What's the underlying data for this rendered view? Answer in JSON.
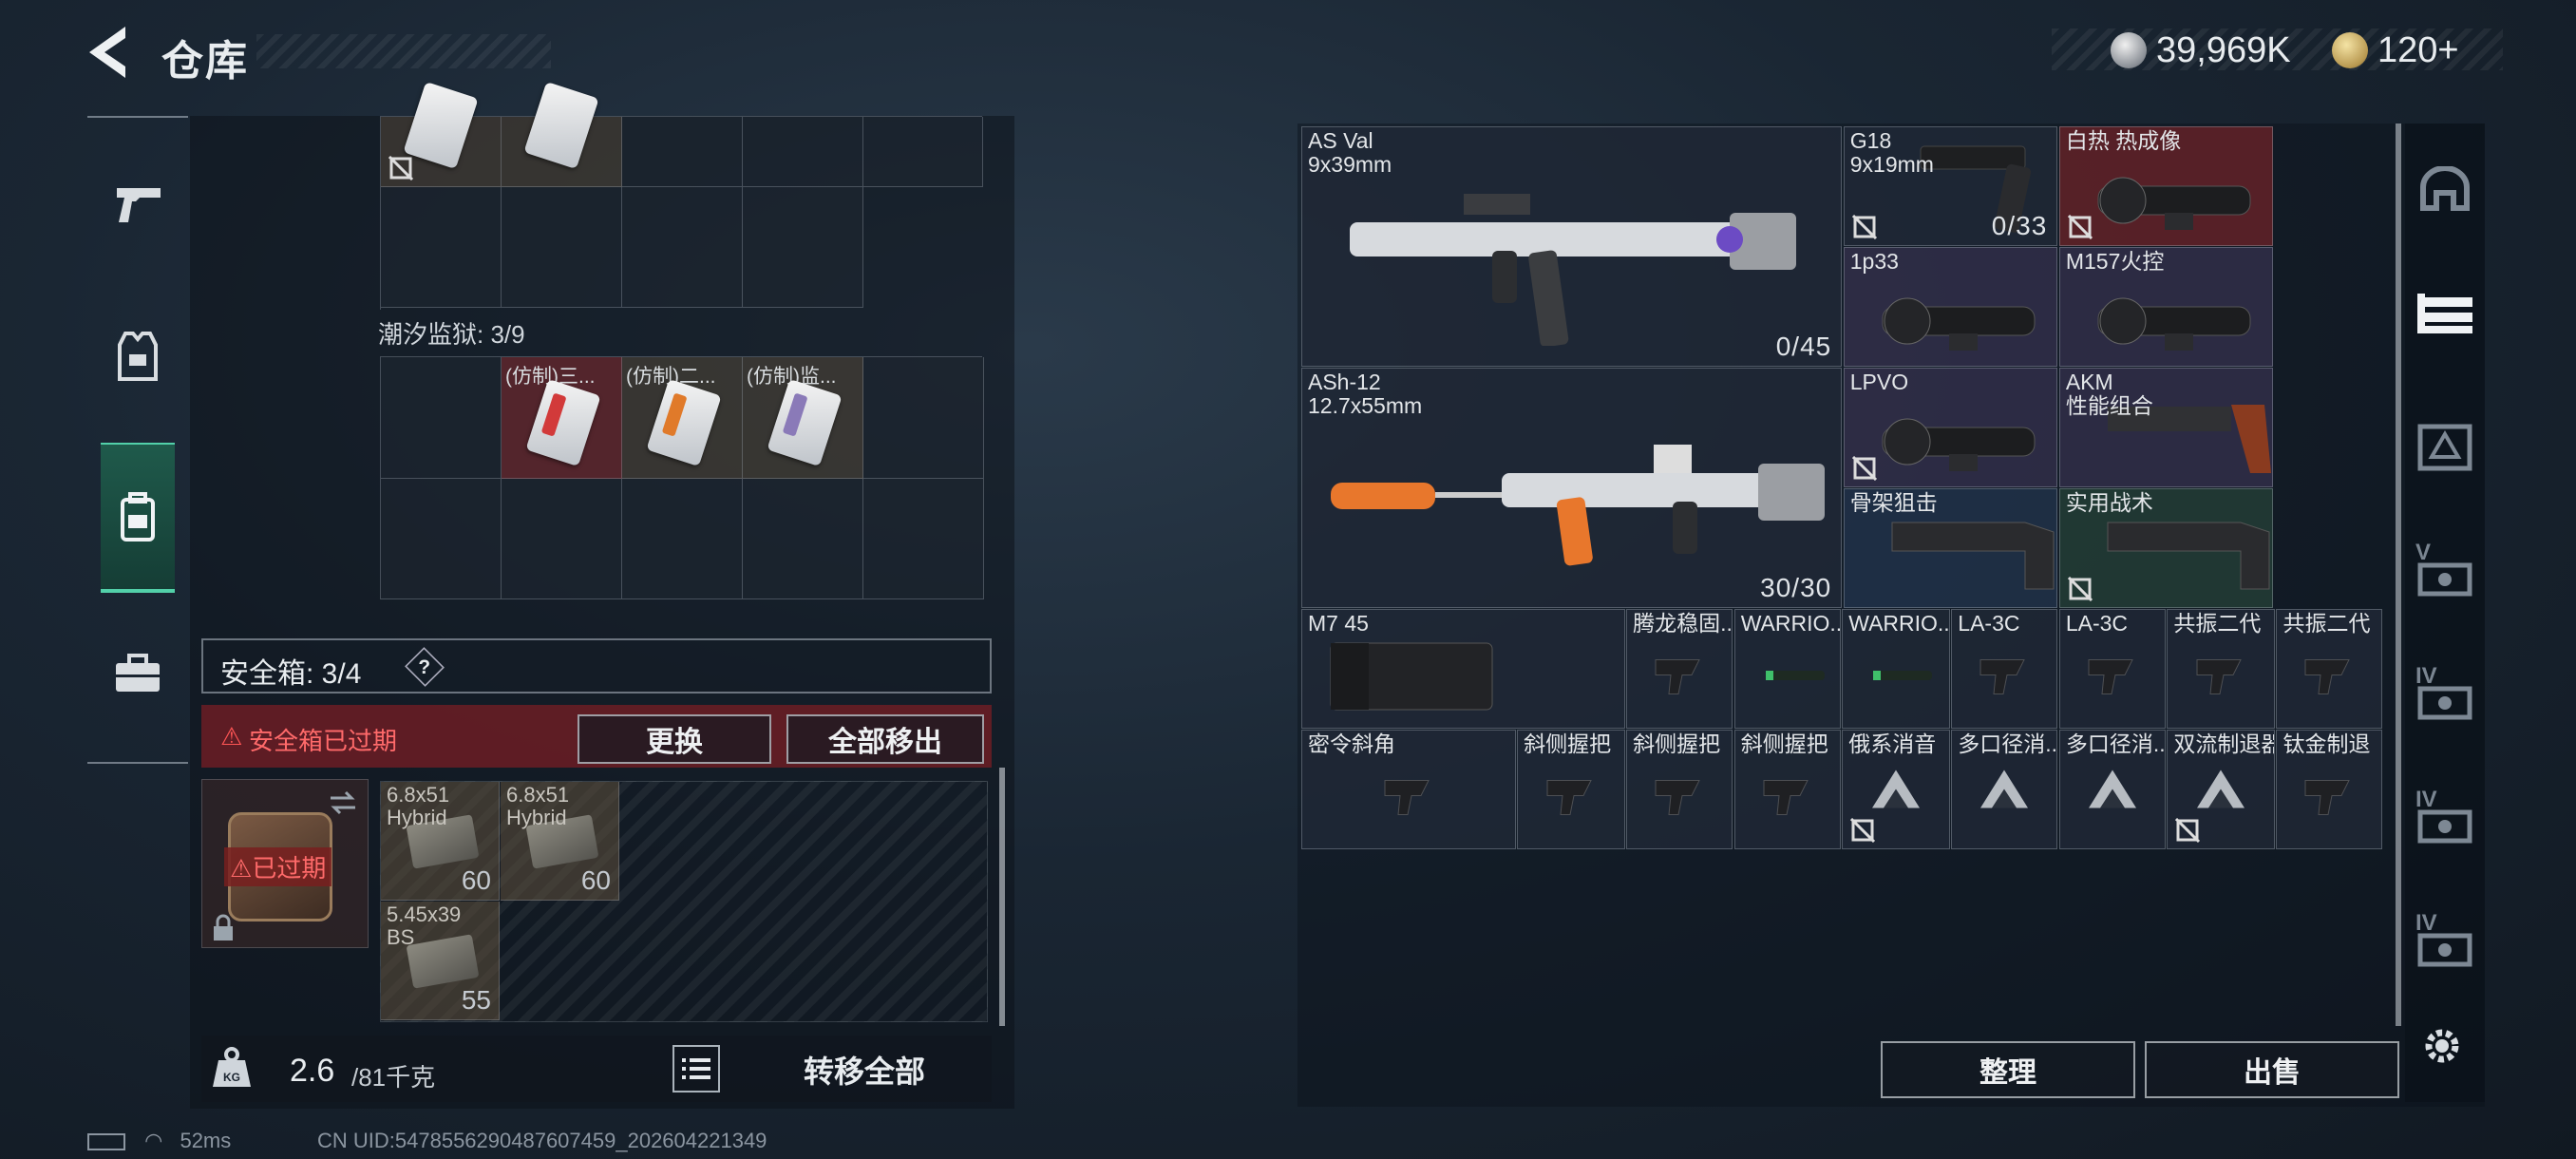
{
  "header": {
    "title": "仓库",
    "silver_amount": "39,969K",
    "gold_amount": "120+"
  },
  "left_tabs": [
    {
      "icon": "pistol-icon"
    },
    {
      "icon": "vest-icon"
    },
    {
      "icon": "backpack-icon",
      "active": true
    },
    {
      "icon": "toolbox-icon"
    }
  ],
  "backpack": {
    "prison_label": "潮汐监狱: 3/9",
    "prison_cards": [
      {
        "name": "(仿制)三...",
        "stripe": "#d23a3a"
      },
      {
        "name": "(仿制)二...",
        "stripe": "#e07a2a"
      },
      {
        "name": "(仿制)监...",
        "stripe": "#8a7ab8"
      }
    ],
    "safe_box": {
      "label": "安全箱: 3/4",
      "help": "?",
      "expired_notice": "安全箱已过期",
      "expired_badge": "已过期",
      "swap_label": "更换",
      "move_all_label": "全部移出"
    },
    "ammo": [
      {
        "name": "6.8x51\nHybrid",
        "count": "60"
      },
      {
        "name": "6.8x51\nHybrid",
        "count": "60"
      },
      {
        "name": "5.45x39\nBS",
        "count": "55"
      }
    ],
    "weight_current": "2.6",
    "weight_max": "/81千克",
    "transfer_all_label": "转移全部"
  },
  "status": {
    "ping": "52ms",
    "uid": "CN UID:5478556290487607459_202604221349"
  },
  "stash": {
    "items": [
      {
        "name": "AS Val\n9x39mm",
        "count": "0/45",
        "kind": "rifle"
      },
      {
        "name": "G18\n9x19mm",
        "count": "0/33",
        "kind": "pistol"
      },
      {
        "name": "白热 热成像",
        "kind": "scope",
        "bg": "red"
      },
      {
        "name": "1p33",
        "kind": "scope",
        "bg": "purple"
      },
      {
        "name": "M157火控",
        "kind": "scope",
        "bg": "purple"
      },
      {
        "name": "ASh-12\n12.7x55mm",
        "count": "30/30",
        "kind": "rifle2"
      },
      {
        "name": "LPVO",
        "kind": "scope",
        "bg": "purple"
      },
      {
        "name": "AKM\n性能组合",
        "kind": "grip",
        "bg": "purple"
      },
      {
        "name": "骨架狙击",
        "kind": "stock",
        "bg": "blue"
      },
      {
        "name": "实用战术",
        "kind": "stock",
        "bg": "green"
      },
      {
        "name": "M7 45",
        "kind": "mag"
      },
      {
        "name": "腾龙稳固...",
        "kind": "small"
      },
      {
        "name": "WARRIO...",
        "kind": "light"
      },
      {
        "name": "WARRIO...",
        "kind": "light"
      },
      {
        "name": "LA-3C",
        "kind": "small"
      },
      {
        "name": "LA-3C",
        "kind": "small"
      },
      {
        "name": "共振二代",
        "kind": "small"
      },
      {
        "name": "共振二代",
        "kind": "small"
      },
      {
        "name": "密令斜角",
        "kind": "small"
      },
      {
        "name": "斜侧握把",
        "kind": "grip"
      },
      {
        "name": "斜侧握把",
        "kind": "grip"
      },
      {
        "name": "斜侧握把",
        "kind": "grip"
      },
      {
        "name": "俄系消音",
        "kind": "tri"
      },
      {
        "name": "多口径消...",
        "kind": "tri"
      },
      {
        "name": "多口径消...",
        "kind": "tri"
      },
      {
        "name": "双流制退器",
        "kind": "tri"
      },
      {
        "name": "钛金制退",
        "kind": "small"
      }
    ],
    "sort_label": "整理",
    "sell_label": "出售"
  },
  "right_rail": [
    {
      "icon": "helmet-icon",
      "level": ""
    },
    {
      "icon": "rifle-rack-icon",
      "level": ""
    },
    {
      "icon": "crate-icon",
      "level": ""
    },
    {
      "icon": "ticket-icon",
      "level": "V"
    },
    {
      "icon": "ticket-icon",
      "level": "IV"
    },
    {
      "icon": "ticket-icon",
      "level": "IV"
    },
    {
      "icon": "ticket-icon",
      "level": "IV"
    }
  ],
  "colors": {
    "accent": "#52d0a9",
    "danger": "#ff5555"
  }
}
